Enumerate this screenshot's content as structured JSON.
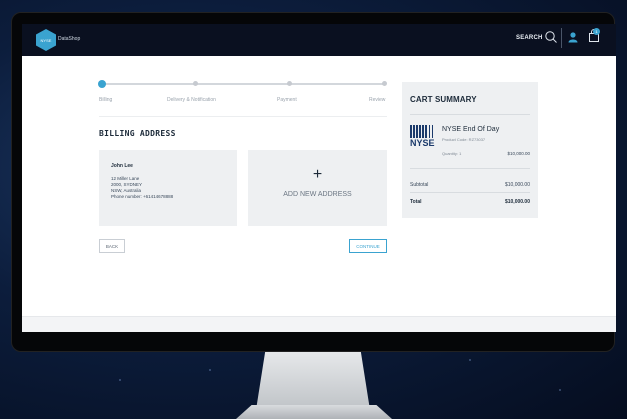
{
  "header": {
    "brand": "DataShop",
    "logo_text": "NYSE",
    "search_label": "SEARCH",
    "cart_count": "1"
  },
  "steps": [
    {
      "label": "Billing",
      "active": true
    },
    {
      "label": "Delivery & Notification",
      "active": false
    },
    {
      "label": "Payment",
      "active": false
    },
    {
      "label": "Review",
      "active": false
    }
  ],
  "billing": {
    "title": "BILLING ADDRESS",
    "address": {
      "name": "John Lee",
      "lines": [
        "12 Miller Lane",
        "2000, SYDNEY",
        "NSW, Australia",
        "Phone number: +61414678888"
      ]
    },
    "add_new": {
      "icon": "plus-icon",
      "label": "ADD NEW ADDRESS"
    },
    "back_label": "BACK",
    "continue_label": "CONTINUE"
  },
  "cart": {
    "title": "CART SUMMARY",
    "item": {
      "logo_text": "NYSE",
      "name": "NYSE End Of Day",
      "code": "Product Code: RZ73037",
      "quantity": "Quantity: 1",
      "price": "$10,000.00"
    },
    "subtotal_label": "Subtotal",
    "subtotal_value": "$10,000.00",
    "total_label": "Total",
    "total_value": "$10,000.00"
  },
  "colors": {
    "accent": "#3aa3d0",
    "nav_bg": "#0a1020",
    "card_bg": "#eef0f2"
  },
  "icons": [
    "search-icon",
    "user-icon",
    "shopping-bag-icon",
    "plus-icon",
    "nyse-logo"
  ]
}
